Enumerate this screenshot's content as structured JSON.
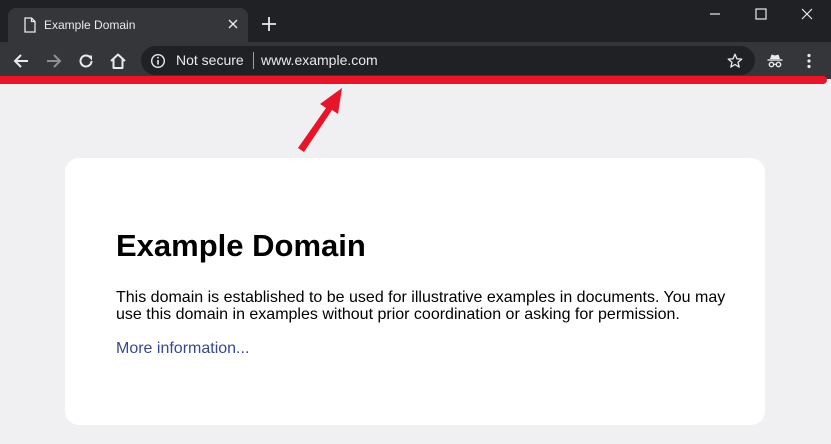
{
  "tab": {
    "title": "Example Domain",
    "close_icon": "close-icon",
    "favicon": "page-icon"
  },
  "window_controls": {
    "minimize_icon": "minimize-icon",
    "maximize_icon": "maximize-icon",
    "close_icon": "close-icon"
  },
  "toolbar": {
    "back_icon": "arrow-left-icon",
    "forward_icon": "arrow-right-icon",
    "reload_icon": "reload-icon",
    "home_icon": "home-icon",
    "incognito_icon": "incognito-icon",
    "menu_icon": "more-vert-icon"
  },
  "omnibox": {
    "security_label": "Not secure",
    "url": "www.example.com",
    "bookmark_icon": "star-icon"
  },
  "annotation": {
    "highlight_color": "#e8152a",
    "arrow_icon": "arrow-up-right-icon"
  },
  "page": {
    "heading": "Example Domain",
    "paragraph": "This domain is established to be used for illustrative examples in documents. You may use this domain in examples without prior coordination or asking for permission.",
    "link_text": "More information...",
    "link_color": "#38488f",
    "background_color": "#f0f0f2"
  }
}
